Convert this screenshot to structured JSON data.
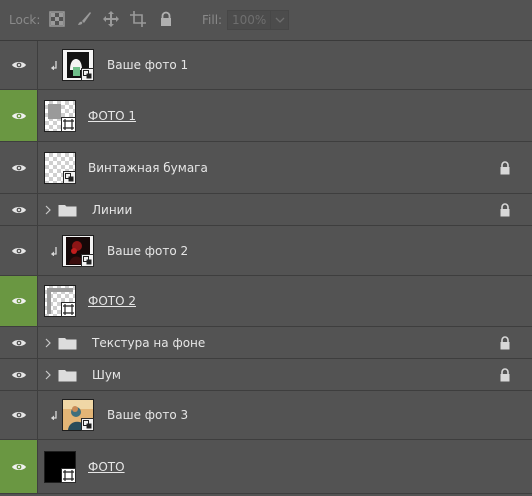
{
  "lockbar": {
    "lock_label": "Lock:",
    "lock_icons": [
      "lock-transparent-pixels-icon",
      "lock-image-pixels-icon",
      "lock-position-icon",
      "lock-artboard-icon",
      "lock-all-icon"
    ],
    "fill_label": "Fill:",
    "fill_value": "100%"
  },
  "layers": [
    {
      "name": "Ваше фото 1",
      "type": "clipped",
      "visible": true,
      "selected": false,
      "locked": false,
      "thumb": "photo-1"
    },
    {
      "name": "ФОТО 1",
      "type": "frame",
      "visible": true,
      "selected": true,
      "locked": false,
      "thumb": "checker"
    },
    {
      "name": "Винтажная бумага",
      "type": "smart-object",
      "visible": true,
      "selected": false,
      "locked": true,
      "thumb": "checker"
    },
    {
      "name": "Линии",
      "type": "group",
      "visible": true,
      "selected": false,
      "locked": true
    },
    {
      "name": "Ваше фото 2",
      "type": "clipped",
      "visible": true,
      "selected": false,
      "locked": false,
      "thumb": "photo-2"
    },
    {
      "name": "ФОТО 2",
      "type": "frame",
      "visible": true,
      "selected": true,
      "locked": false,
      "thumb": "checker"
    },
    {
      "name": "Текстура на фоне",
      "type": "group",
      "visible": true,
      "selected": false,
      "locked": true
    },
    {
      "name": "Шум",
      "type": "group",
      "visible": true,
      "selected": false,
      "locked": true
    },
    {
      "name": "Ваше фото 3",
      "type": "clipped",
      "visible": true,
      "selected": false,
      "locked": false,
      "thumb": "photo-3"
    },
    {
      "name": "ФОТО",
      "type": "frame",
      "visible": true,
      "selected": true,
      "locked": false,
      "thumb": "black"
    }
  ],
  "colors": {
    "panel": "#535353",
    "selected_eye": "#6a9742",
    "text": "#e6e6e6"
  }
}
